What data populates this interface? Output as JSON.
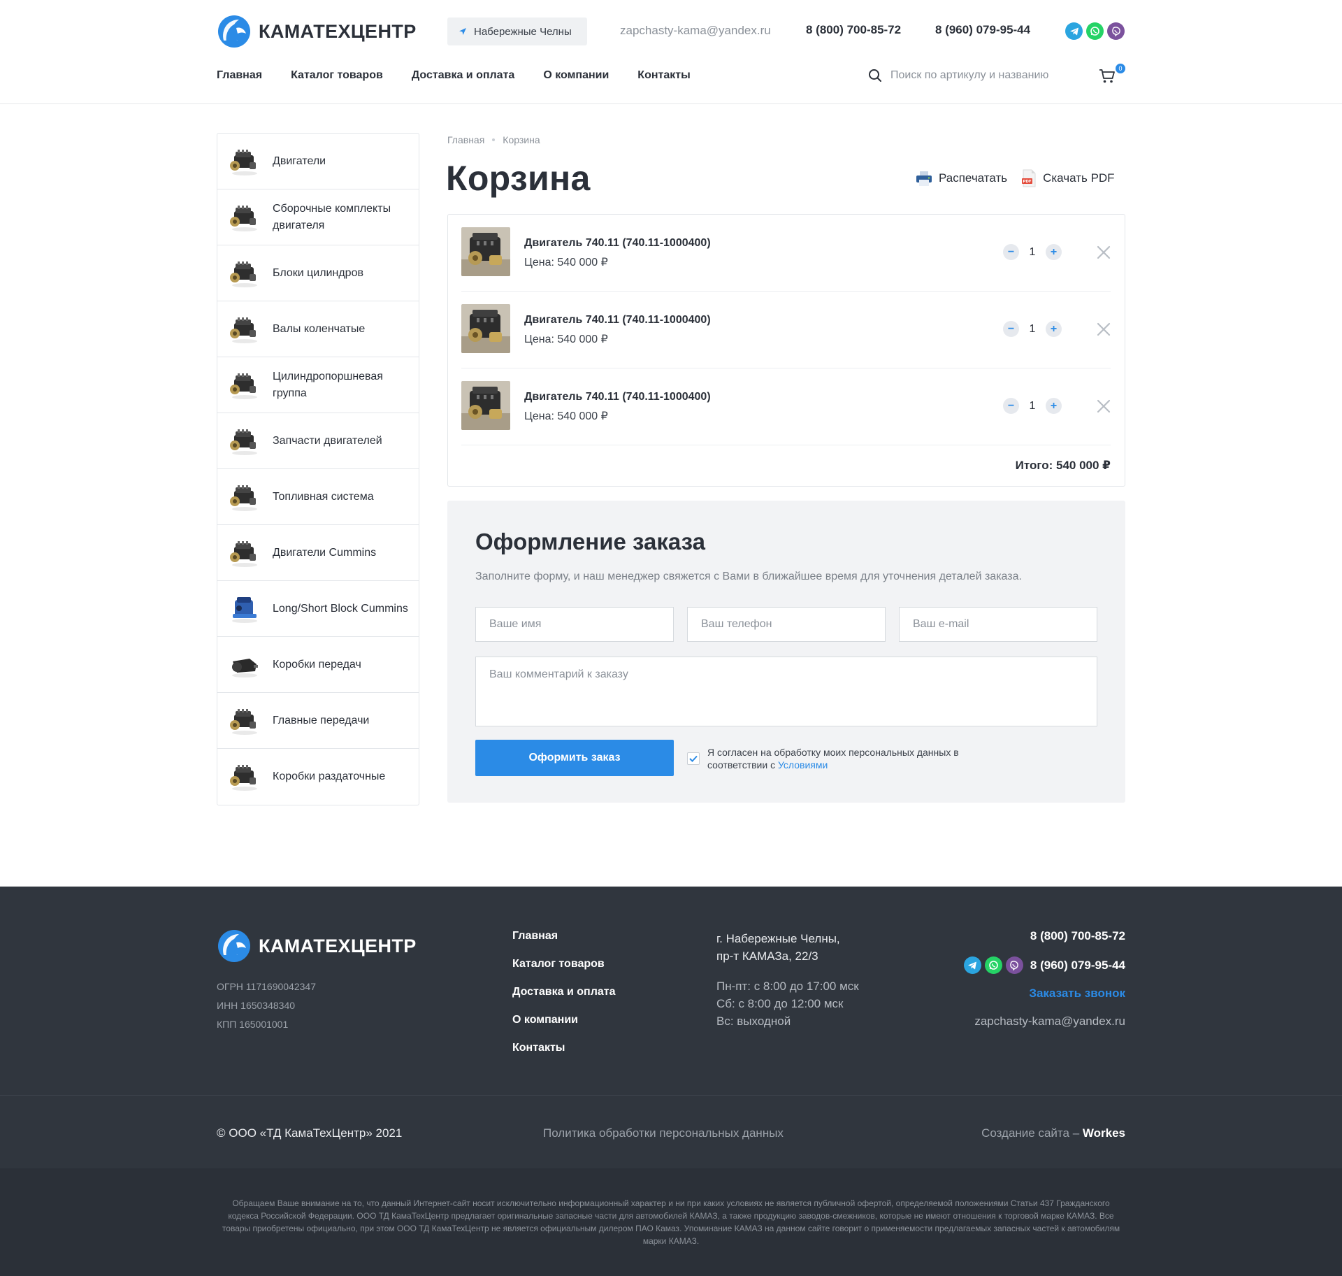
{
  "brand": {
    "name": "КАМАТЕХЦЕНТР",
    "colors": {
      "accent": "#2b8be6",
      "text": "#2b3039",
      "footer_bg": "#30363e"
    }
  },
  "header": {
    "city": "Набережные Челны",
    "email": "zapchasty-kama@yandex.ru",
    "phone1": "8 (800) 700-85-72",
    "phone2": "8 (960) 079-95-44",
    "messengers": [
      "telegram-icon",
      "whatsapp-icon",
      "viber-icon"
    ],
    "nav": [
      "Главная",
      "Каталог товаров",
      "Доставка и оплата",
      "О компании",
      "Контакты"
    ],
    "search_placeholder": "Поиск по артикулу и названию",
    "cart_count": "0"
  },
  "sidebar": {
    "items": [
      {
        "label": "Двигатели"
      },
      {
        "label": "Сборочные комплекты двигателя"
      },
      {
        "label": "Блоки цилиндров"
      },
      {
        "label": "Валы коленчатые"
      },
      {
        "label": "Цилиндропоршневая группа"
      },
      {
        "label": "Запчасти двигателей"
      },
      {
        "label": "Топливная система"
      },
      {
        "label": "Двигатели Cummins"
      },
      {
        "label": "Long/Short Block Cummins"
      },
      {
        "label": "Коробки передач"
      },
      {
        "label": "Главные передачи"
      },
      {
        "label": "Коробки раздаточные"
      }
    ]
  },
  "breadcrumb": [
    "Главная",
    "Корзина"
  ],
  "page_title": "Корзина",
  "actions": {
    "print": "Распечатать",
    "pdf": "Скачать PDF",
    "pdf_badge": "PDF"
  },
  "cart": {
    "items": [
      {
        "name": "Двигатель 740.11 (740.11-1000400)",
        "price": "Цена: 540 000 ₽",
        "qty": "1"
      },
      {
        "name": "Двигатель 740.11 (740.11-1000400)",
        "price": "Цена: 540 000 ₽",
        "qty": "1"
      },
      {
        "name": "Двигатель 740.11 (740.11-1000400)",
        "price": "Цена: 540 000 ₽",
        "qty": "1"
      }
    ],
    "total": "Итого: 540 000 ₽"
  },
  "order": {
    "title": "Оформление заказа",
    "subtitle": "Заполните форму, и наш менеджер свяжется с Вами в ближайшее время для уточнения деталей заказа.",
    "name_placeholder": "Ваше имя",
    "phone_placeholder": "Ваш телефон",
    "email_placeholder": "Ваш e-mail",
    "comment_placeholder": "Ваш комментарий к заказу",
    "submit": "Оформить заказ",
    "consent_text": "Я согласен на обработку моих персональных данных в соответствии с ",
    "consent_link": "Условиями",
    "consent_checked": true
  },
  "footer": {
    "logo": "КАМАТЕХЦЕНТР",
    "legal": [
      "ОГРН 1171690042347",
      "ИНН 1650348340",
      "КПП 165001001"
    ],
    "nav": [
      "Главная",
      "Каталог товаров",
      "Доставка и оплата",
      "О компании",
      "Контакты"
    ],
    "address": [
      "г. Набережные Челны,",
      "пр-т КАМАЗа, 22/3"
    ],
    "hours": [
      "Пн-пт: с 8:00 до 17:00 мск",
      "Сб: с 8:00 до 12:00 мск",
      "Вс: выходной"
    ],
    "phone1": "8 (800) 700-85-72",
    "phone2": "8 (960) 079-95-44",
    "callback": "Заказать звонок",
    "email": "zapchasty-kama@yandex.ru",
    "copyright": "© ООО «ТД КамаТехЦентр» 2021",
    "policy": "Политика обработки персональных данных",
    "made_by_prefix": "Создание сайта – ",
    "made_by": "Workes",
    "disclaimer": "Обращаем Ваше внимание на то, что данный Интернет-сайт носит исключительно информационный характер и ни при каких условиях не является публичной офертой, определяемой положениями Статьи 437 Гражданского кодекса Российской Федерации. ООО ТД КамаТехЦентр предлагает оригинальные запасные части для автомобилей КАМАЗ, а также продукцию заводов-смежников, которые не имеют отношения к торговой марке КАМАЗ. Все товары приобретены официально, при этом ООО ТД КамаТехЦентр не является официальным дилером ПАО Камаз. Упоминание КАМАЗ на данном сайте говорит о применяемости предлагаемых запасных частей к автомобилям марки КАМАЗ."
  }
}
